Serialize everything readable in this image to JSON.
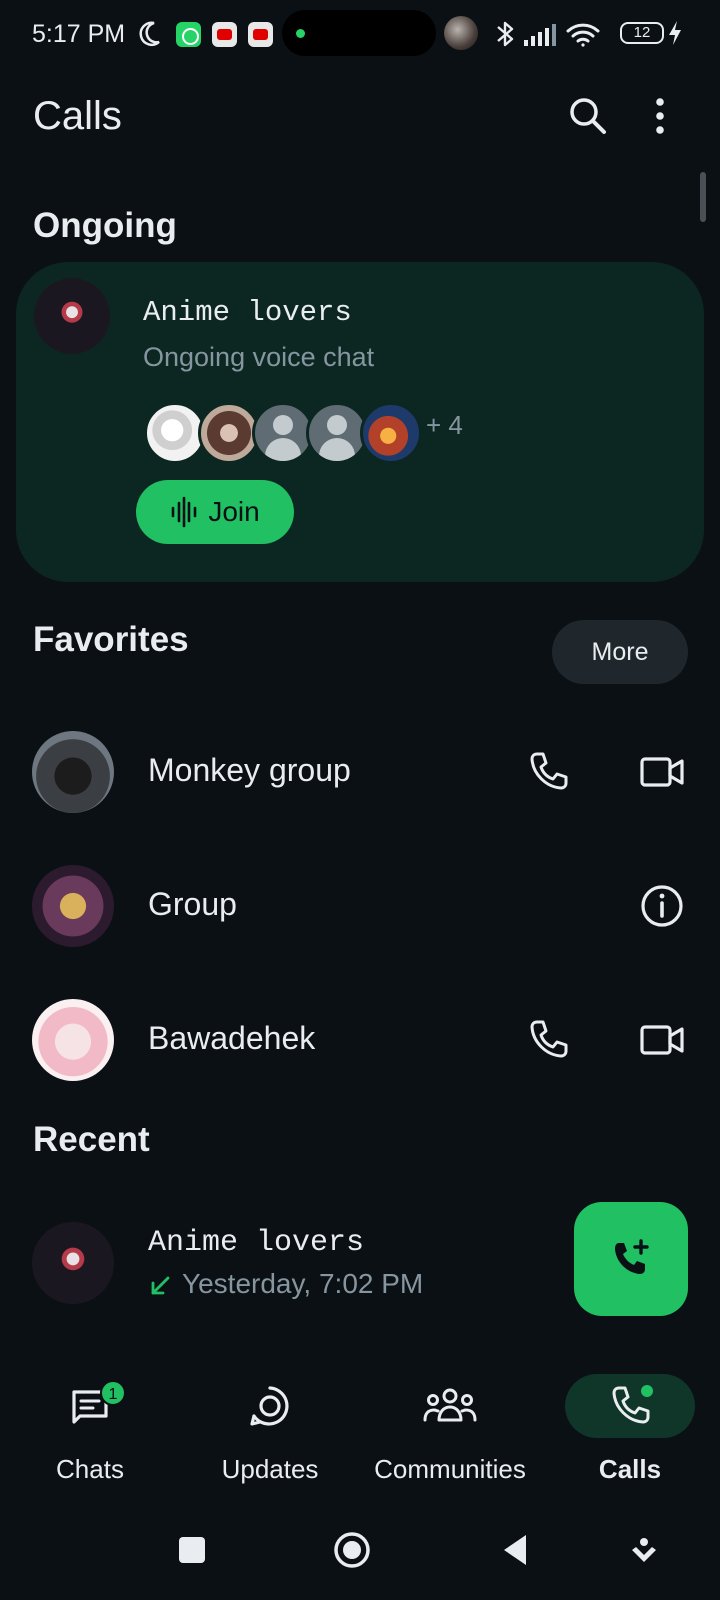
{
  "status_bar": {
    "time": "5:17 PM",
    "battery": "12",
    "icons": [
      "moon-icon",
      "whatsapp-notification-icon",
      "youtube-notification-icon",
      "youtube-notification-icon",
      "bluetooth-icon",
      "signal-icon",
      "wifi-icon",
      "battery-icon",
      "charging-icon"
    ]
  },
  "header": {
    "title": "Calls",
    "search_icon": "search-icon",
    "menu_icon": "more-vert-icon"
  },
  "ongoing": {
    "section_title": "Ongoing",
    "name": "Anime lovers",
    "subtitle": "Ongoing voice chat",
    "extra_participants": "+ 4",
    "join_label": "Join"
  },
  "favorites": {
    "section_title": "Favorites",
    "more_label": "More",
    "items": [
      {
        "name": "Monkey group",
        "actions": [
          "call",
          "video"
        ]
      },
      {
        "name": "Group",
        "actions": [
          "info"
        ]
      },
      {
        "name": "Bawadehek",
        "actions": [
          "call",
          "video"
        ]
      }
    ]
  },
  "recent": {
    "section_title": "Recent",
    "items": [
      {
        "name": "Anime lovers",
        "time": "Yesterday, 7:02 PM",
        "direction": "incoming"
      }
    ]
  },
  "fab": {
    "icon": "add-call-icon"
  },
  "bottom_nav": {
    "items": [
      {
        "label": "Chats",
        "badge": "1"
      },
      {
        "label": "Updates"
      },
      {
        "label": "Communities"
      },
      {
        "label": "Calls",
        "active": true
      }
    ]
  },
  "colors": {
    "background": "#0b1014",
    "accent": "#21c063",
    "card": "#0c2721",
    "secondary_text": "#8696a0"
  }
}
